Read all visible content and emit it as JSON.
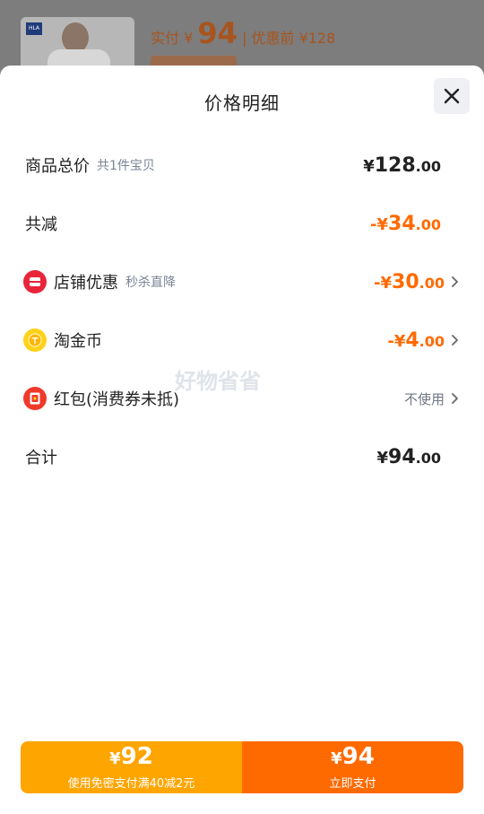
{
  "background": {
    "price_prefix": "实付 ¥",
    "price_value": "94",
    "original_label": "| 优惠前 ¥128"
  },
  "sheet": {
    "title": "价格明细"
  },
  "rows": {
    "total": {
      "label": "商品总价",
      "sub": "共1件宝贝",
      "yen": "¥",
      "int": "128",
      "dec": ".00"
    },
    "reduce": {
      "label": "共减",
      "yen": "-¥",
      "int": "34",
      "dec": ".00"
    },
    "shop": {
      "label": "店铺优惠",
      "sub": "秒杀直降",
      "yen": "-¥",
      "int": "30",
      "dec": ".00"
    },
    "coin": {
      "label": "淘金币",
      "yen": "-¥",
      "int": "4",
      "dec": ".00"
    },
    "redpack": {
      "label": "红包(消费券未抵)",
      "action": "不使用"
    },
    "sum": {
      "label": "合计",
      "yen": "¥",
      "int": "94",
      "dec": ".00"
    }
  },
  "watermark": "好物省省",
  "bottom": {
    "left": {
      "yen": "¥",
      "price": "92",
      "text": "使用免密支付满40减2元"
    },
    "right": {
      "yen": "¥",
      "price": "94",
      "text": "立即支付"
    }
  },
  "colors": {
    "accent_orange": "#ff6a00",
    "accent_amber": "#ffa500",
    "text_dark": "#222222",
    "text_sub": "#7a8597"
  },
  "icons": {
    "close": "close-icon",
    "chevron": "chevron-right-icon",
    "shop": "shop-coupon-icon",
    "coin": "gold-coin-icon",
    "redpack": "red-packet-icon"
  }
}
